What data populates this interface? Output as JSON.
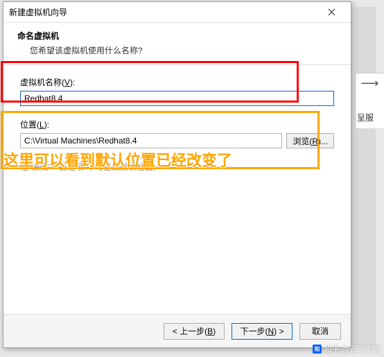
{
  "dialog": {
    "title": "新建虚拟机向导",
    "header_title": "命名虚拟机",
    "header_sub": "您希望该虚拟机使用什么名称?"
  },
  "fields": {
    "name_label_pre": "虚拟机名称(",
    "name_label_u": "V",
    "name_label_post": "):",
    "name_value": "Redhat8.4",
    "loc_label_pre": "位置(",
    "loc_label_u": "L",
    "loc_label_post": "):",
    "loc_value": "C:\\Virtual Machines\\Redhat8.4",
    "browse_pre": "浏览(",
    "browse_u": "R",
    "browse_post": ")..."
  },
  "hint": {
    "pre": "在\"编辑\">\"首选项\"中可更改默认位置。"
  },
  "annotation_text": "这里可以看到默认位置已经改变了",
  "footer": {
    "back_pre": "< 上一步(",
    "back_u": "B",
    "back_post": ")",
    "next_pre": "下一步(",
    "next_u": "N",
    "next_post": ") >",
    "cancel": "取消"
  },
  "bg": {
    "char1": "⟶",
    "text1": "呈服"
  },
  "watermark": "知乎 @云贝学院"
}
